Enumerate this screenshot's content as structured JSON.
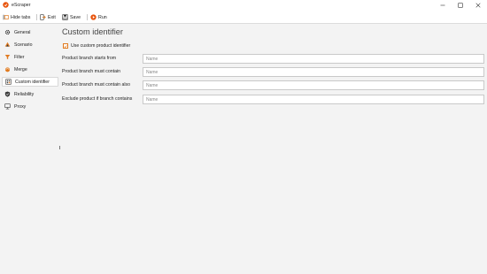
{
  "window": {
    "title": "eScraper"
  },
  "toolbar": {
    "hide_tabs": "Hide tabs",
    "exit": "Exit",
    "save": "Save",
    "run": "Run"
  },
  "sidebar": {
    "items": [
      {
        "label": "General",
        "icon": "gear-icon"
      },
      {
        "label": "Scenario",
        "icon": "scenario-icon"
      },
      {
        "label": "Filter",
        "icon": "filter-icon"
      },
      {
        "label": "Merge",
        "icon": "merge-icon"
      },
      {
        "label": "Custom identifier",
        "icon": "custom-identifier-icon",
        "active": true
      },
      {
        "label": "Reliability",
        "icon": "shield-icon"
      },
      {
        "label": "Proxy",
        "icon": "proxy-icon"
      }
    ]
  },
  "main": {
    "title": "Custom identifier",
    "use_custom": {
      "label": "Use custom product identifier",
      "checked": true
    },
    "fields": [
      {
        "label": "Product branch starts from",
        "placeholder": "Name",
        "value": ""
      },
      {
        "label": "Product branch must contain",
        "placeholder": "Name",
        "value": ""
      },
      {
        "label": "Product branch must contain also",
        "placeholder": "Name",
        "value": ""
      },
      {
        "label": "Exclude product if branch contains",
        "placeholder": "Name",
        "value": ""
      }
    ]
  },
  "colors": {
    "accent": "#e07a1f",
    "logo": "#e8540c"
  }
}
